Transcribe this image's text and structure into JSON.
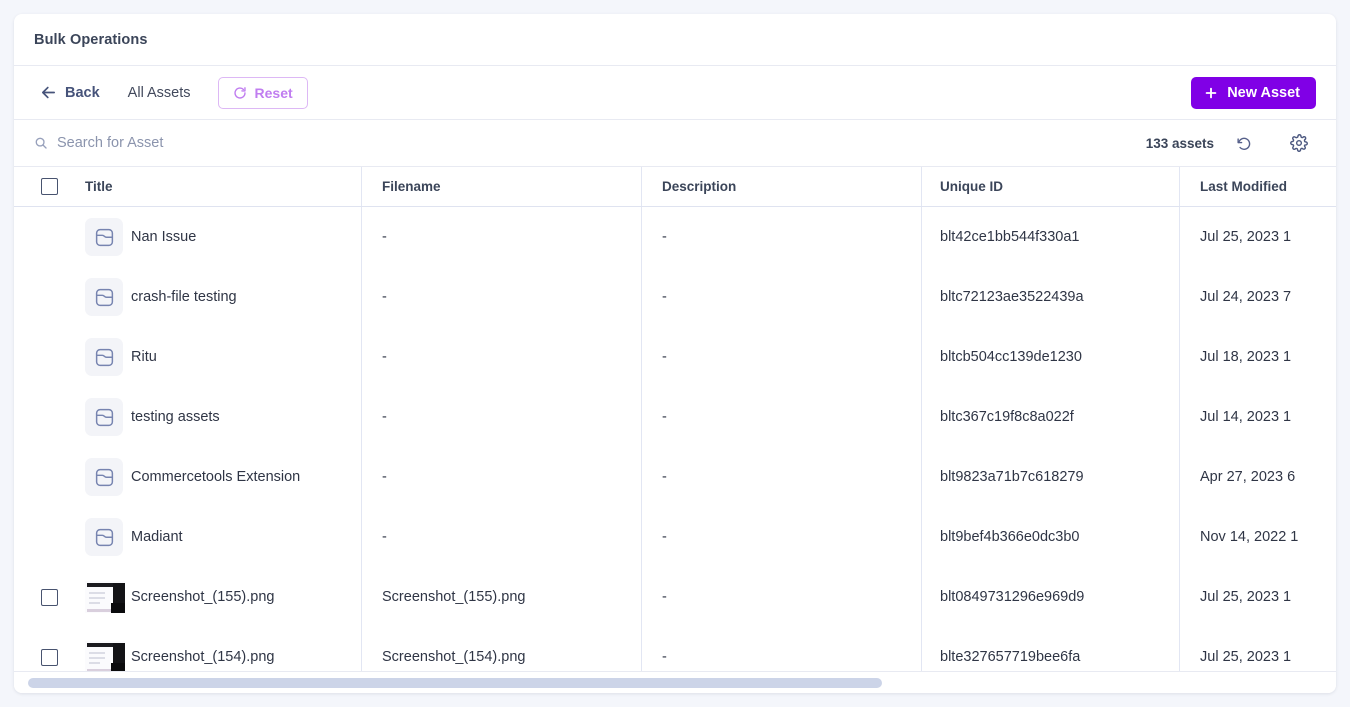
{
  "window": {
    "title": "Bulk Operations"
  },
  "actionbar": {
    "back_label": "Back",
    "breadcrumb_current": "All Assets",
    "reset_label": "Reset",
    "new_asset_label": "New Asset",
    "accent_purple": "#8000e6",
    "reset_purple": "#c07df0"
  },
  "search": {
    "value": "",
    "placeholder": "Search for Asset",
    "asset_count": "133 assets"
  },
  "table": {
    "columns": [
      {
        "key": "title",
        "label": "Title"
      },
      {
        "key": "filename",
        "label": "Filename"
      },
      {
        "key": "description",
        "label": "Description"
      },
      {
        "key": "unique_id",
        "label": "Unique ID"
      },
      {
        "key": "last_modified",
        "label": "Last Modified"
      }
    ],
    "rows": [
      {
        "kind": "folder",
        "selectable": false,
        "title": "Nan Issue",
        "filename": "-",
        "description": "-",
        "unique_id": "blt42ce1bb544f330a1",
        "last_modified": "Jul 25, 2023 1"
      },
      {
        "kind": "folder",
        "selectable": false,
        "title": "crash-file testing",
        "filename": "-",
        "description": "-",
        "unique_id": "bltc72123ae3522439a",
        "last_modified": "Jul 24, 2023 7"
      },
      {
        "kind": "folder",
        "selectable": false,
        "title": "Ritu",
        "filename": "-",
        "description": "-",
        "unique_id": "bltcb504cc139de1230",
        "last_modified": "Jul 18, 2023 1"
      },
      {
        "kind": "folder",
        "selectable": false,
        "title": "testing assets",
        "filename": "-",
        "description": "-",
        "unique_id": "bltc367c19f8c8a022f",
        "last_modified": "Jul 14, 2023 1"
      },
      {
        "kind": "folder",
        "selectable": false,
        "title": "Commercetools Extension",
        "filename": "-",
        "description": "-",
        "unique_id": "blt9823a71b7c618279",
        "last_modified": "Apr 27, 2023 6"
      },
      {
        "kind": "folder",
        "selectable": false,
        "title": "Madiant",
        "filename": "-",
        "description": "-",
        "unique_id": "blt9bef4b366e0dc3b0",
        "last_modified": "Nov 14, 2022 1"
      },
      {
        "kind": "image",
        "selectable": true,
        "title": "Screenshot_(155).png",
        "filename": "Screenshot_(155).png",
        "description": "-",
        "unique_id": "blt0849731296e969d9",
        "last_modified": "Jul 25, 2023 1"
      },
      {
        "kind": "image",
        "selectable": true,
        "title": "Screenshot_(154).png",
        "filename": "Screenshot_(154).png",
        "description": "-",
        "unique_id": "blte327657719bee6fa",
        "last_modified": "Jul 25, 2023 1"
      }
    ]
  },
  "icons": {
    "back": "arrow-left-icon",
    "reset": "refresh-icon",
    "new_asset": "plus-icon",
    "search": "search-icon",
    "refresh": "undo-icon",
    "settings": "gear-icon",
    "folder": "folder-icon"
  },
  "scrollbar": {
    "thumb_width_percent": "66%"
  }
}
